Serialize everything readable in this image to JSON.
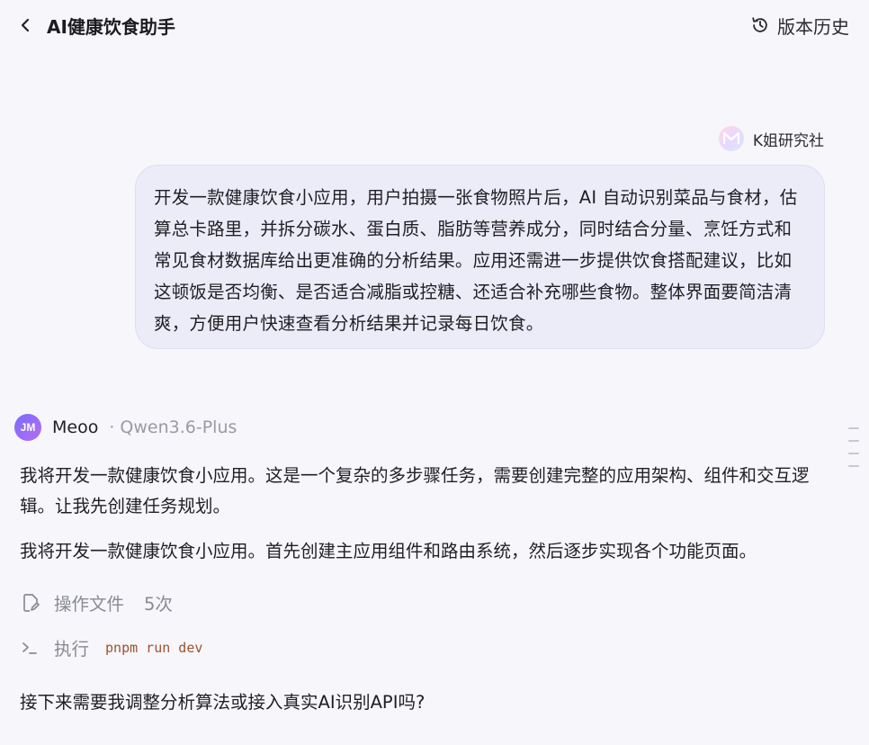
{
  "header": {
    "title": "AI健康饮食助手",
    "history_label": "版本历史"
  },
  "user": {
    "name": "K姐研究社",
    "message": "开发一款健康饮食小应用，用户拍摄一张食物照片后，AI 自动识别菜品与食材，估算总卡路里，并拆分碳水、蛋白质、脂肪等营养成分，同时结合分量、烹饪方式和常见食材数据库给出更准确的分析结果。应用还需进一步提供饮食搭配建议，比如这顿饭是否均衡、是否适合减脂或控糖、还适合补充哪些食物。整体界面要简洁清爽，方便用户快速查看分析结果并记录每日饮食。"
  },
  "assistant": {
    "avatar_text": "JM",
    "name": "Meoo",
    "model": "· Qwen3.6-Plus",
    "para1": "我将开发一款健康饮食小应用。这是一个复杂的多步骤任务，需要创建完整的应用架构、组件和交互逻辑。让我先创建任务规划。",
    "para2": "我将开发一款健康饮食小应用。首先创建主应用组件和路由系统，然后逐步实现各个功能页面。",
    "tool_files_label": "操作文件",
    "tool_files_count": "5次",
    "tool_exec_label": "执行",
    "tool_exec_cmd": "pnpm run dev",
    "para3": "接下来需要我调整分析算法或接入真实AI识别API吗?"
  },
  "icons": {
    "back": "chevron-left-icon",
    "history": "history-icon",
    "file_edit": "file-edit-icon",
    "terminal": "terminal-icon"
  }
}
